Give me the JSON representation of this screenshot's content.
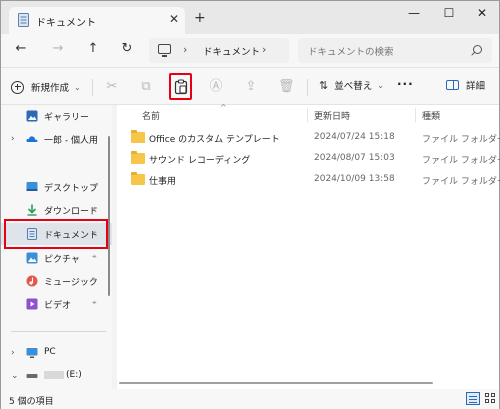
{
  "tab": {
    "title": "ドキュメント",
    "close": "✕",
    "new": "+"
  },
  "window_controls": {
    "minimize": "—",
    "maximize": "☐",
    "close": "✕"
  },
  "nav": {
    "back": "←",
    "forward": "→",
    "up": "↑",
    "refresh": "↻",
    "breadcrumb_sep": "›",
    "address": "ドキュメント",
    "address_sep_end": "›",
    "search_placeholder": "ドキュメントの検索"
  },
  "command": {
    "new_label": "新規作成",
    "new_chevron": "⌄",
    "cut": "✂",
    "copy": "⧉",
    "rename": "Ⓐ",
    "share": "⇪",
    "delete": "🗑",
    "sort_icon": "⇅",
    "sort_label": "並べ替え",
    "sort_chevron": "⌄",
    "more": "···",
    "details_label": "詳細"
  },
  "sidebar": {
    "items": [
      {
        "label": "ギャラリー",
        "icon": "gallery-icon"
      },
      {
        "label": "一郎 - 個人用",
        "icon": "cloud-icon",
        "chevron": "›"
      },
      {
        "label": "デスクトップ",
        "icon": "desktop-icon",
        "pin": "📌"
      },
      {
        "label": "ダウンロード",
        "icon": "download-icon",
        "pin": "📌"
      },
      {
        "label": "ドキュメント",
        "icon": "document-icon",
        "pin": "📌"
      },
      {
        "label": "ピクチャ",
        "icon": "pictures-icon",
        "pin": "📌"
      },
      {
        "label": "ミュージック",
        "icon": "music-icon",
        "pin": "📌"
      },
      {
        "label": "ビデオ",
        "icon": "video-icon",
        "pin": "📌"
      },
      {
        "label": "PC",
        "icon": "pc-icon",
        "chevron": "›"
      },
      {
        "label": "(E:)",
        "icon": "drive-icon",
        "chevron": "⌄"
      }
    ]
  },
  "list": {
    "headers": {
      "name": "名前",
      "modified": "更新日時",
      "type": "種類",
      "sort_caret": "^"
    },
    "rows": [
      {
        "name": "Office のカスタム テンプレート",
        "modified": "2024/07/24 15:18",
        "type": "ファイル フォルダー"
      },
      {
        "name": "サウンド レコーディング",
        "modified": "2024/08/07 15:03",
        "type": "ファイル フォルダー"
      },
      {
        "name": "仕事用",
        "modified": "2024/10/09 13:58",
        "type": "ファイル フォルダー"
      }
    ]
  },
  "status": {
    "item_count": "5 個の項目"
  },
  "colors": {
    "highlight": "#e60012",
    "accent": "#2b6ab5",
    "folder": "#f5c648"
  }
}
